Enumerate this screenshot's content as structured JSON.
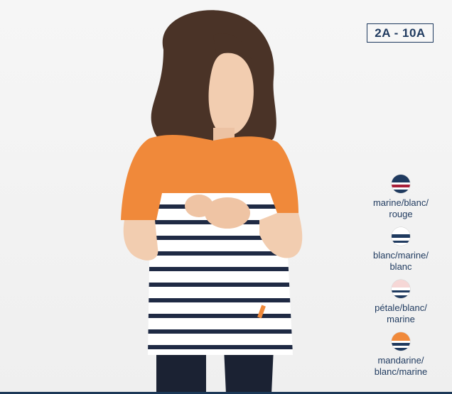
{
  "size_badge": "2A - 10A",
  "colors": {
    "navy": "#1f3a5f",
    "orange": "#f0893a",
    "red": "#a8203a",
    "petal": "#f6d7d6",
    "white": "#ffffff"
  },
  "swatches": [
    {
      "label": "marine/blanc/\nrouge",
      "icon": "stripe-swatch-marine-blanc-rouge"
    },
    {
      "label": "blanc/marine/\nblanc",
      "icon": "stripe-swatch-blanc-marine-blanc"
    },
    {
      "label": "pétale/blanc/\nmarine",
      "icon": "stripe-swatch-petale-blanc-marine"
    },
    {
      "label": "mandarine/\nblanc/marine",
      "icon": "stripe-swatch-mandarine-blanc-marine"
    }
  ]
}
